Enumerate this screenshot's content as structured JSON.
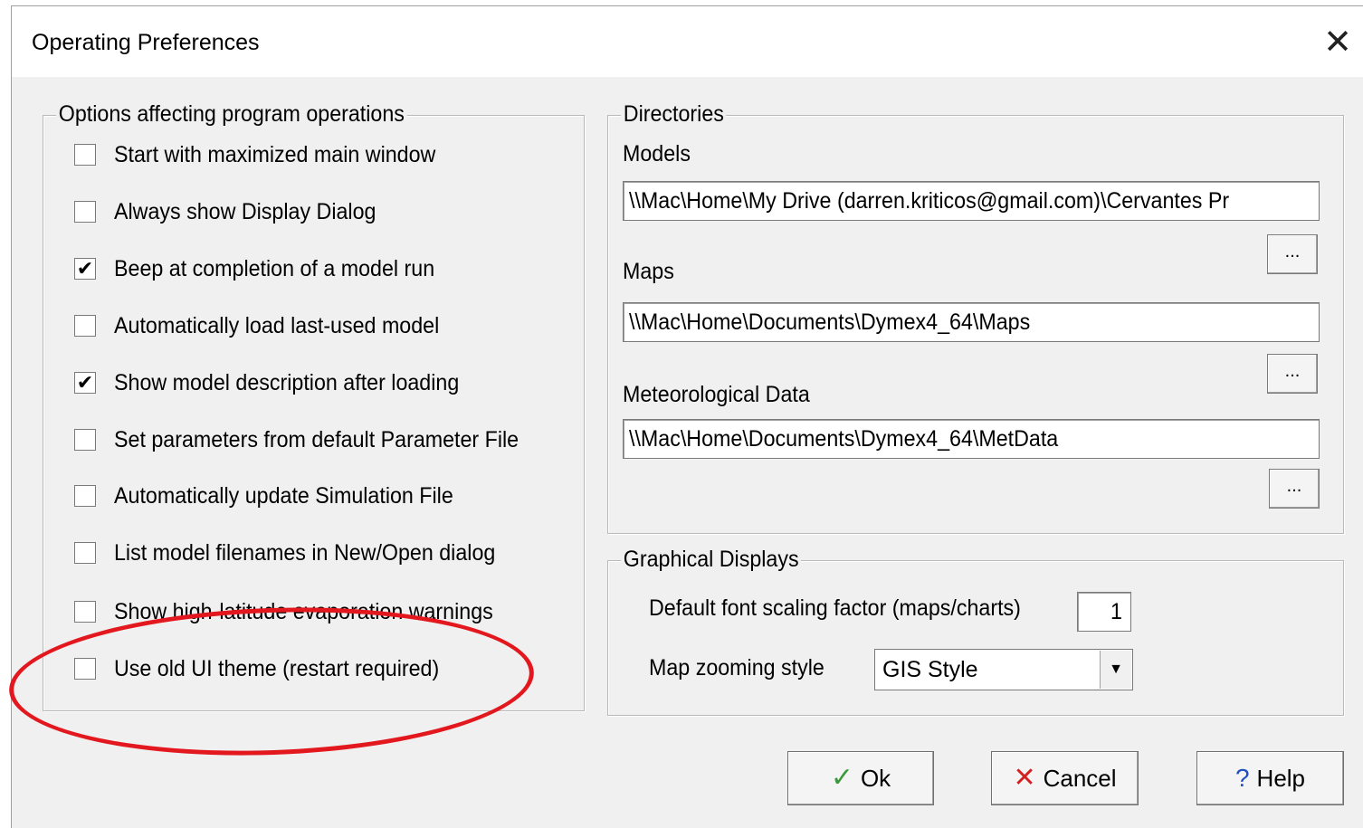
{
  "window": {
    "title": "Operating Preferences",
    "close_icon": "close-icon"
  },
  "options_group": {
    "title": "Options affecting program operations",
    "items": [
      {
        "label": "Start with maximized main window",
        "checked": false
      },
      {
        "label": "Always show Display Dialog",
        "checked": false
      },
      {
        "label": "Beep at completion of a model run",
        "checked": true
      },
      {
        "label": "Automatically load last-used model",
        "checked": false
      },
      {
        "label": "Show model description after loading",
        "checked": true
      },
      {
        "label": "Set parameters from default Parameter File",
        "checked": false
      },
      {
        "label": "Automatically update Simulation File",
        "checked": false
      },
      {
        "label": "List model filenames in New/Open dialog",
        "checked": false
      },
      {
        "label": "Show high-latitude evaporation warnings",
        "checked": false
      },
      {
        "label": "Use old UI theme (restart required)",
        "checked": false
      }
    ]
  },
  "directories_group": {
    "title": "Directories",
    "models_label": "Models",
    "models_value": "\\\\Mac\\Home\\My Drive (darren.kriticos@gmail.com)\\Cervantes Pr",
    "maps_label": "Maps",
    "maps_value": "\\\\Mac\\Home\\Documents\\Dymex4_64\\Maps",
    "met_label": "Meteorological Data",
    "met_value": "\\\\Mac\\Home\\Documents\\Dymex4_64\\MetData",
    "browse_label": "..."
  },
  "graphics_group": {
    "title": "Graphical Displays",
    "font_scale_label": "Default font scaling factor (maps/charts)",
    "font_scale_value": "1",
    "zoom_label": "Map zooming style",
    "zoom_value": "GIS Style"
  },
  "buttons": {
    "ok_label": "Ok",
    "ok_icon": "check-icon",
    "cancel_label": "Cancel",
    "cancel_icon": "x-icon",
    "help_label": "Help",
    "help_icon": "question-icon"
  },
  "colors": {
    "dialog_bg": "#f0f0f0",
    "ok_check": "#3a9a3a",
    "cancel_x": "#d42020",
    "help_q": "#2050c0",
    "annotation": "#e3181f"
  }
}
